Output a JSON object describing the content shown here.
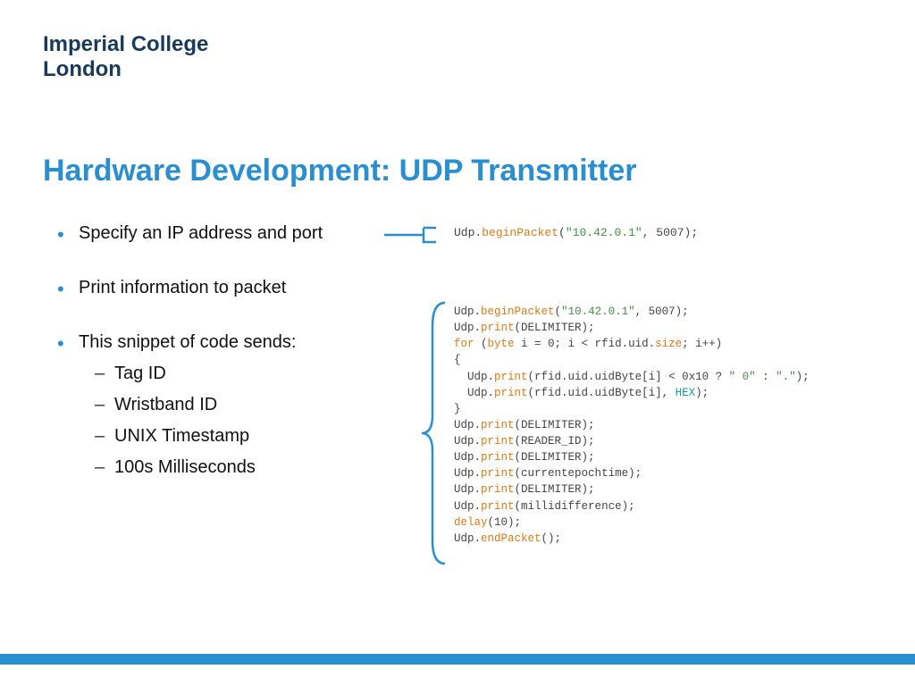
{
  "logo": {
    "line1": "Imperial College",
    "line2": "London"
  },
  "title": "Hardware Development: UDP Transmitter",
  "bullets": {
    "b1": "Specify an IP address and port",
    "b2": "Print information to packet",
    "b3": "This snippet of code sends:",
    "sub": {
      "s1": "Tag ID",
      "s2": "Wristband ID",
      "s3": "UNIX Timestamp",
      "s4": "100s Milliseconds"
    }
  },
  "code1": {
    "obj": "Udp",
    "dot": ".",
    "method": "beginPacket",
    "open": "(",
    "ip": "\"10.42.0.1\"",
    "comma": ", ",
    "port": "5007",
    "close": ");"
  },
  "code2": {
    "l1": {
      "a": "Udp",
      "b": ".",
      "c": "beginPacket",
      "d": "(",
      "e": "\"10.42.0.1\"",
      "f": ", ",
      "g": "5007",
      "h": ");"
    },
    "l2": {
      "a": "Udp",
      "b": ".",
      "c": "print",
      "d": "(DELIMITER);"
    },
    "l3": {
      "a": "for",
      "b": " (",
      "c": "byte",
      "d": " i = 0; i < rfid.uid.",
      "e": "size",
      "f": "; i++)"
    },
    "l4": "{",
    "l5": {
      "a": "  Udp",
      "b": ".",
      "c": "print",
      "d": "(rfid.uid.uidByte[i] < 0x10 ? ",
      "e": "\" 0\"",
      "f": " : ",
      "g": "\".\"",
      "h": ");"
    },
    "l6": {
      "a": "  Udp",
      "b": ".",
      "c": "print",
      "d": "(rfid.uid.uidByte[i], ",
      "e": "HEX",
      "f": ");"
    },
    "l7": "}",
    "l8": {
      "a": "Udp",
      "b": ".",
      "c": "print",
      "d": "(DELIMITER);"
    },
    "l9": {
      "a": "Udp",
      "b": ".",
      "c": "print",
      "d": "(READER_ID);"
    },
    "l10": {
      "a": "Udp",
      "b": ".",
      "c": "print",
      "d": "(DELIMITER);"
    },
    "l11": {
      "a": "Udp",
      "b": ".",
      "c": "print",
      "d": "(currentepochtime);"
    },
    "l12": {
      "a": "Udp",
      "b": ".",
      "c": "print",
      "d": "(DELIMITER);"
    },
    "l13": {
      "a": "Udp",
      "b": ".",
      "c": "print",
      "d": "(millidifference);"
    },
    "l14": {
      "a": "delay",
      "b": "(10);"
    },
    "l15": {
      "a": "Udp",
      "b": ".",
      "c": "endPacket",
      "d": "();"
    }
  }
}
